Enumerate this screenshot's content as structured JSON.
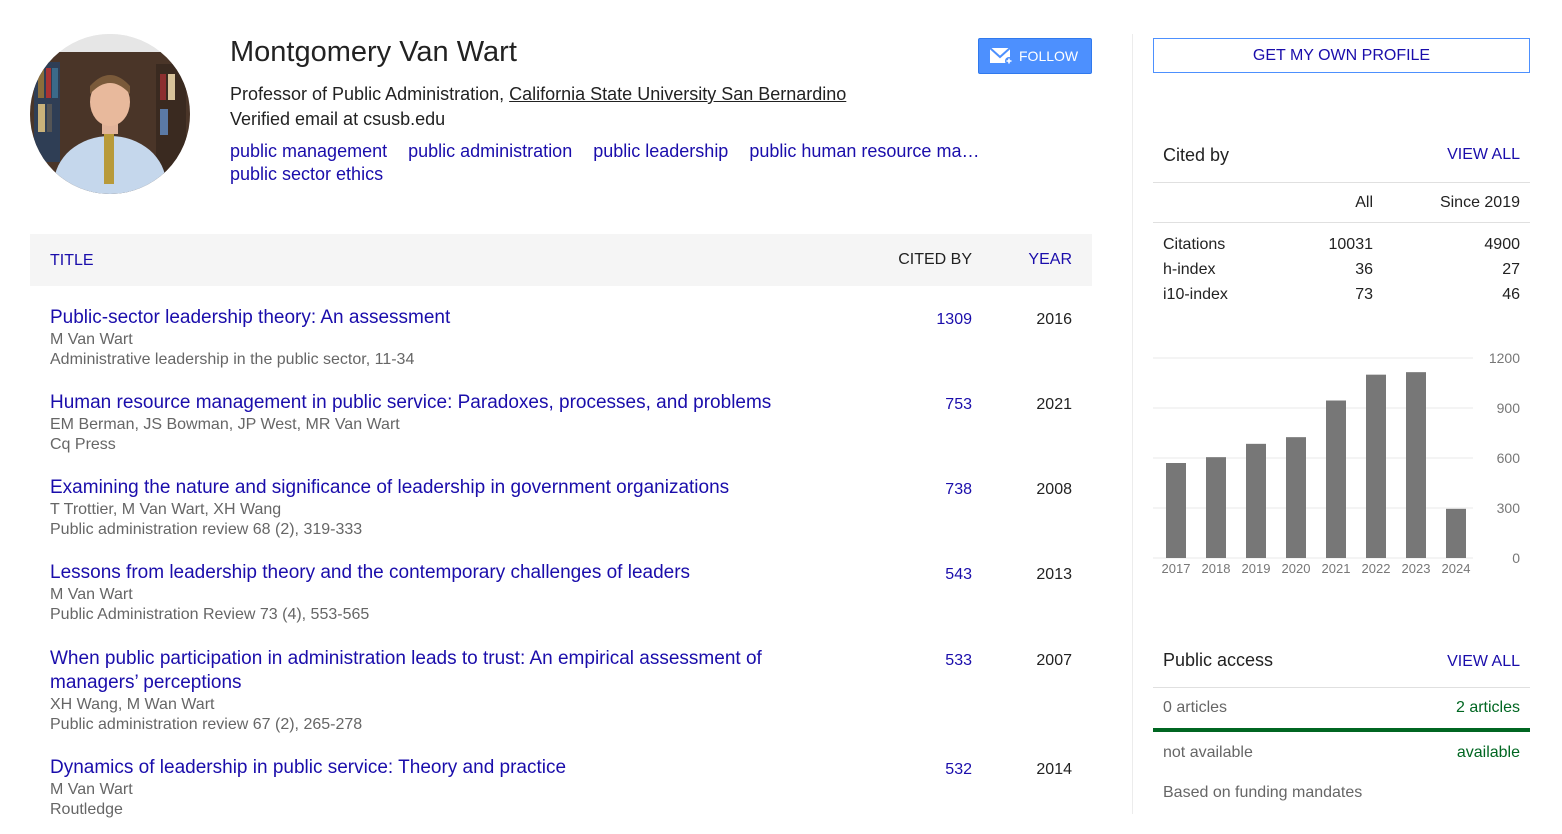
{
  "profile": {
    "name": "Montgomery Van Wart",
    "follow_label": "FOLLOW",
    "title": "Professor of Public Administration, ",
    "university": "California State University San Bernardino",
    "email": "Verified email at csusb.edu",
    "interests": [
      "public management",
      "public administration",
      "public leadership",
      "public human resource ma…",
      "public sector ethics"
    ]
  },
  "table": {
    "col_title": "TITLE",
    "col_cited": "CITED BY",
    "col_year": "YEAR",
    "rows": [
      {
        "title": "Public-sector leadership theory: An assessment",
        "authors": "M Van Wart",
        "venue": "Administrative leadership in the public sector, 11-34",
        "cited": "1309",
        "year": "2016"
      },
      {
        "title": "Human resource management in public service: Paradoxes, processes, and problems",
        "authors": "EM Berman, JS Bowman, JP West, MR Van Wart",
        "venue": "Cq Press",
        "cited": "753",
        "year": "2021"
      },
      {
        "title": "Examining the nature and significance of leadership in government organizations",
        "authors": "T Trottier, M Van Wart, XH Wang",
        "venue": "Public administration review 68 (2), 319-333",
        "cited": "738",
        "year": "2008"
      },
      {
        "title": "Lessons from leadership theory and the contemporary challenges of leaders",
        "authors": "M Van Wart",
        "venue": "Public Administration Review 73 (4), 553-565",
        "cited": "543",
        "year": "2013"
      },
      {
        "title": "When public participation in administration leads to trust: An empirical assessment of managers’ perceptions",
        "authors": "XH Wang, M Wan Wart",
        "venue": "Public administration review 67 (2), 265-278",
        "cited": "533",
        "year": "2007"
      },
      {
        "title": "Dynamics of leadership in public service: Theory and practice",
        "authors": "M Van Wart",
        "venue": "Routledge",
        "cited": "532",
        "year": "2014"
      }
    ]
  },
  "sidebar": {
    "get_profile_label": "GET MY OWN PROFILE",
    "cited_by": {
      "title": "Cited by",
      "view_all": "VIEW ALL",
      "col_all": "All",
      "col_since": "Since 2019",
      "rows": [
        {
          "label": "Citations",
          "all": "10031",
          "since": "4900"
        },
        {
          "label": "h-index",
          "all": "36",
          "since": "27"
        },
        {
          "label": "i10-index",
          "all": "73",
          "since": "46"
        }
      ]
    },
    "public_access": {
      "title": "Public access",
      "view_all": "VIEW ALL",
      "left_count": "0 articles",
      "right_count": "2 articles",
      "left_status": "not available",
      "right_status": "available",
      "footer": "Based on funding mandates"
    }
  },
  "chart_data": {
    "type": "bar",
    "categories": [
      "2017",
      "2018",
      "2019",
      "2020",
      "2021",
      "2022",
      "2023",
      "2024"
    ],
    "values": [
      570,
      605,
      685,
      725,
      945,
      1100,
      1115,
      295
    ],
    "ylim": [
      0,
      1200
    ],
    "yticks": [
      0,
      300,
      600,
      900,
      1200
    ],
    "title": "",
    "xlabel": "",
    "ylabel": "",
    "bar_color": "#777777"
  },
  "colors": {
    "link": "#1a0dab",
    "follow_bg": "#4d90fe",
    "available_green": "#006621"
  }
}
